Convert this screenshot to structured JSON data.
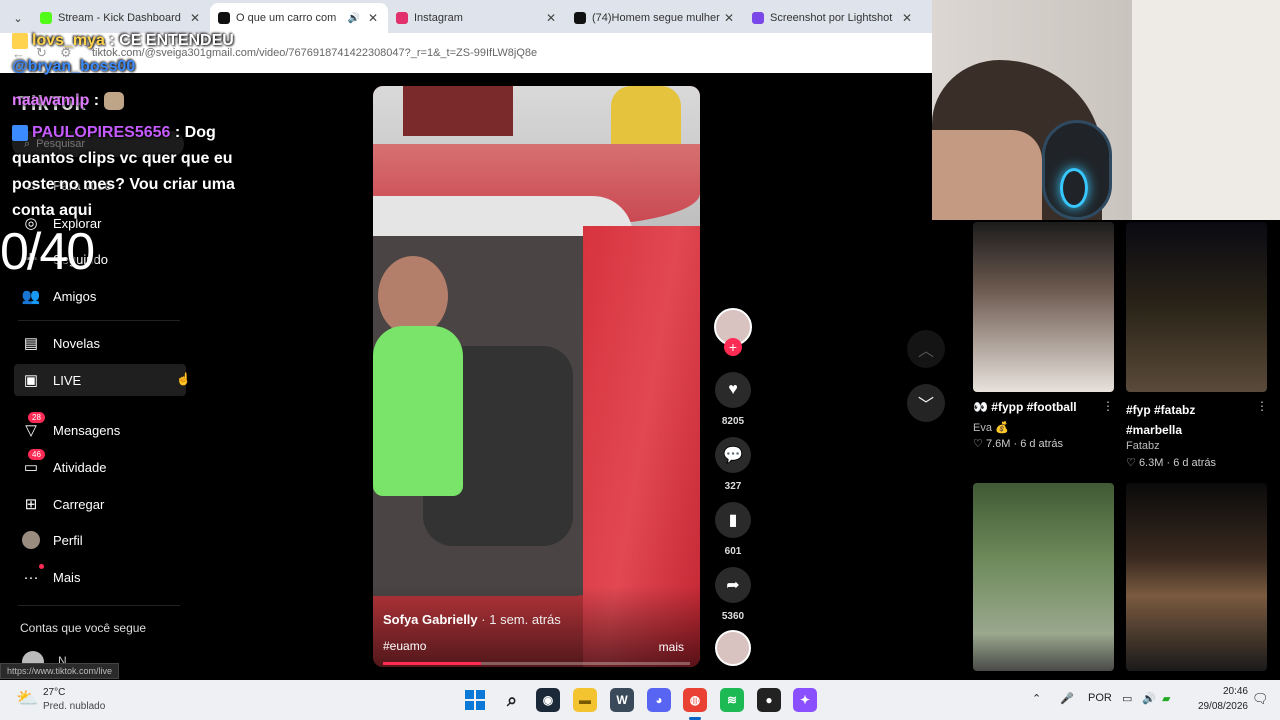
{
  "browser": {
    "tabs": [
      {
        "title": "Stream - Kick Dashboard",
        "color": "#53fc18"
      },
      {
        "title": "O que um carro com",
        "color": "#111111",
        "active": true
      },
      {
        "title": "Instagram",
        "color": "#e1306c"
      },
      {
        "title": "(74)Homem segue mulher",
        "color": "#111111"
      },
      {
        "title": "Screenshot por Lightshot",
        "color": "#7a48e8"
      }
    ],
    "url": "tiktok.com/@sveiga301gmail.com/video/7676918741422308047?_r=1&_t=ZS-99IfLW8jQ8e"
  },
  "sidebar": {
    "logo": "TikTok",
    "search_placeholder": "Pesquisar",
    "items": [
      {
        "label": "Para você",
        "icon": "home-icon"
      },
      {
        "label": "Explorar",
        "icon": "compass-icon"
      },
      {
        "label": "Seguindo",
        "icon": "following-icon"
      },
      {
        "label": "Amigos",
        "icon": "friends-icon"
      },
      {
        "label": "Novelas",
        "icon": "film-icon"
      },
      {
        "label": "LIVE",
        "icon": "live-icon"
      },
      {
        "label": "Mensagens",
        "icon": "message-icon",
        "badge": "28"
      },
      {
        "label": "Atividade",
        "icon": "activity-icon",
        "badge": "46"
      },
      {
        "label": "Carregar",
        "icon": "upload-icon"
      },
      {
        "label": "Perfil",
        "icon": "avatar"
      },
      {
        "label": "Mais",
        "icon": "more-icon"
      }
    ],
    "following_title": "Contas que você segue",
    "following_user": "N.",
    "status_url": "https://www.tiktok.com/live"
  },
  "chat": [
    {
      "user": "lovs_mya",
      "sep": " : ",
      "text": "CE ENTENDEU"
    },
    {
      "user": "@bryan_boss00",
      "sep": "",
      "text": ""
    },
    {
      "user": "naawamip",
      "sep": " : ",
      "text": ""
    },
    {
      "user": "PAULOPIRES5656",
      "sep": " : ",
      "text": "Dog quantos clips vc quer que eu poste no mes? Vou criar uma conta aqui"
    }
  ],
  "counter": "0/40",
  "video": {
    "author": "Sofya Gabrielly",
    "time": "· 1 sem. atrás",
    "hashtag": "#euamo",
    "more": "mais",
    "progress": 0.32
  },
  "actions": {
    "likes": "8205",
    "comments": "327",
    "saves": "601",
    "shares": "5360"
  },
  "related": [
    {
      "title": "👀 #fypp #football",
      "author": "Eva 💰",
      "views": "7.6M",
      "when": "6 d atrás"
    },
    {
      "title": "#fyp #fatabz #marbella",
      "author": "Fatabz",
      "views": "6.3M",
      "when": "6 d atrás"
    }
  ],
  "taskbar": {
    "temp": "27°C",
    "weather": "Pred. nublado",
    "lang": "POR",
    "time": "20:46",
    "date": "29/08/2026"
  }
}
